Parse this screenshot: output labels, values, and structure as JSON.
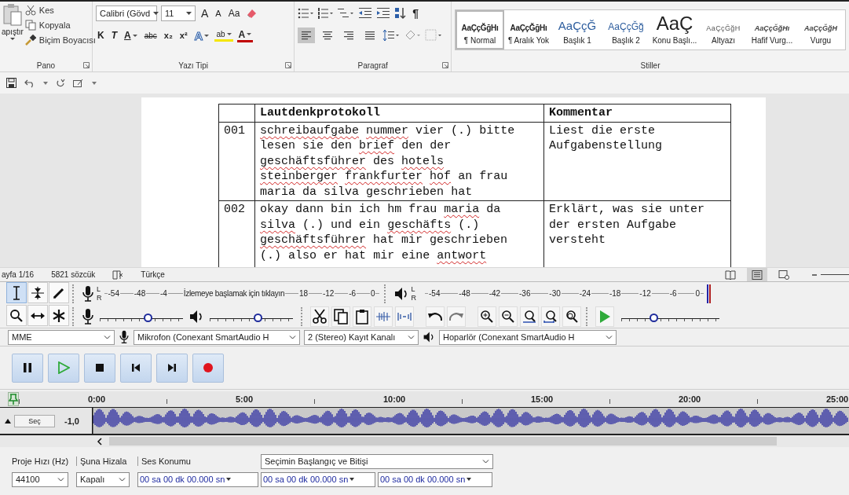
{
  "ribbon": {
    "groups": [
      {
        "kind": "clipboard",
        "label": "Pano",
        "paste": "apıştır",
        "items": [
          {
            "kind": "cut",
            "label": "Kes"
          },
          {
            "kind": "copy",
            "label": "Kopyala"
          },
          {
            "kind": "painter",
            "label": "Biçim Boyacısı"
          }
        ]
      },
      {
        "kind": "font",
        "label": "Yazı Tipi",
        "font_name": "Calibri (Gövd",
        "font_size": "11",
        "size_buttons": [
          {
            "kind": "grow",
            "label": "A"
          },
          {
            "kind": "shrink",
            "label": "A"
          }
        ],
        "case_button": "Aa",
        "format_buttons": [
          {
            "kind": "bold",
            "label": "K"
          },
          {
            "kind": "italic",
            "label": "T"
          },
          {
            "kind": "underline",
            "label": "A"
          },
          {
            "kind": "strike",
            "label": "abc"
          },
          {
            "kind": "sub",
            "label": "x₂"
          },
          {
            "kind": "sup",
            "label": "x²"
          },
          {
            "kind": "effects",
            "label": "A"
          },
          {
            "kind": "highlight",
            "label": "ab"
          },
          {
            "kind": "color",
            "label": "A"
          }
        ]
      },
      {
        "kind": "paragraph",
        "label": "Paragraf",
        "pilcrow": "¶",
        "align": [
          {
            "kind": "left",
            "selected": true
          },
          {
            "kind": "center",
            "selected": false
          },
          {
            "kind": "right",
            "selected": false
          },
          {
            "kind": "justify",
            "selected": false
          }
        ]
      },
      {
        "kind": "styles",
        "label": "Stiller",
        "styles": [
          {
            "preview": "AaÇçĞğHı",
            "name": "¶ Normal",
            "kind": "normal",
            "selected": true
          },
          {
            "preview": "AaÇçĞğHı",
            "name": "¶ Aralık Yok",
            "kind": "normal",
            "selected": false
          },
          {
            "preview": "AaÇçĞ",
            "name": "Başlık 1",
            "kind": "heading1",
            "selected": false
          },
          {
            "preview": "AaÇçĞğ",
            "name": "Başlık 2",
            "kind": "heading2",
            "selected": false
          },
          {
            "preview": "AaÇ",
            "name": "Konu Başlı...",
            "kind": "title",
            "selected": false
          },
          {
            "preview": "AaÇçĞğH",
            "name": "Altyazı",
            "kind": "subtitle",
            "selected": false
          },
          {
            "preview": "AaÇçĞğHı",
            "name": "Hafif Vurg...",
            "kind": "emphasis",
            "selected": false
          },
          {
            "preview": "AaÇçĞğH",
            "name": "Vurgu",
            "kind": "emphasis",
            "selected": false
          }
        ]
      }
    ]
  },
  "document": {
    "columns": [
      "Lautdenkprotokoll",
      "Kommentar"
    ],
    "rows": [
      {
        "number": "001",
        "comment": "Liest die erste Aufgabenstellung",
        "lines": [
          [
            {
              "text": "schreibaufgabe",
              "misspelled": true
            },
            {
              "text": "nummer",
              "misspelled": true
            },
            {
              "text": "vier",
              "misspelled": false
            },
            {
              "text": "(.)",
              "misspelled": false
            },
            {
              "text": "bitte",
              "misspelled": false
            }
          ],
          [
            {
              "text": "lesen",
              "misspelled": false
            },
            {
              "text": "sie",
              "misspelled": false
            },
            {
              "text": "den",
              "misspelled": false
            },
            {
              "text": "brief",
              "misspelled": true
            },
            {
              "text": "den",
              "misspelled": false
            },
            {
              "text": "der",
              "misspelled": false
            }
          ],
          [
            {
              "text": "geschäftsführer",
              "misspelled": true
            },
            {
              "text": "des",
              "misspelled": false
            },
            {
              "text": "hotels",
              "misspelled": true
            }
          ],
          [
            {
              "text": "steinberger",
              "misspelled": true
            },
            {
              "text": "frankfurter",
              "misspelled": true
            },
            {
              "text": "hof",
              "misspelled": true
            },
            {
              "text": "an",
              "misspelled": false
            },
            {
              "text": "frau",
              "misspelled": false
            }
          ],
          [
            {
              "text": "maria",
              "misspelled": false
            },
            {
              "text": "da",
              "misspelled": false
            },
            {
              "text": "silva",
              "misspelled": false
            },
            {
              "text": "geschrieben",
              "misspelled": false
            },
            {
              "text": "hat",
              "misspelled": false
            }
          ]
        ]
      },
      {
        "number": "002",
        "comment": "Erklärt, was sie unter der ersten Aufgabe versteht",
        "lines": [
          [
            {
              "text": "okay",
              "misspelled": false
            },
            {
              "text": "dann",
              "misspelled": false
            },
            {
              "text": "bin",
              "misspelled": false
            },
            {
              "text": "ich",
              "misspelled": false
            },
            {
              "text": "hm",
              "misspelled": false
            },
            {
              "text": "frau",
              "misspelled": false
            },
            {
              "text": "maria",
              "misspelled": true
            },
            {
              "text": "da",
              "misspelled": false
            }
          ],
          [
            {
              "text": "silva",
              "misspelled": true
            },
            {
              "text": "(.)",
              "misspelled": false
            },
            {
              "text": "und",
              "misspelled": false
            },
            {
              "text": "ein",
              "misspelled": false
            },
            {
              "text": "geschäfts",
              "misspelled": true
            },
            {
              "text": "(.)",
              "misspelled": false
            }
          ],
          [
            {
              "text": "geschäftsführer",
              "misspelled": true
            },
            {
              "text": "hat",
              "misspelled": false
            },
            {
              "text": "mir",
              "misspelled": false
            },
            {
              "text": "geschrieben",
              "misspelled": false
            }
          ],
          [
            {
              "text": "(.)",
              "misspelled": false
            },
            {
              "text": "also",
              "misspelled": false
            },
            {
              "text": "er",
              "misspelled": false
            },
            {
              "text": "hat",
              "misspelled": false
            },
            {
              "text": "mir",
              "misspelled": false
            },
            {
              "text": "eine",
              "misspelled": false
            },
            {
              "text": "antwort",
              "misspelled": true
            }
          ]
        ]
      }
    ]
  },
  "status_bar": {
    "page": "ayfa 1/16",
    "words": "5821 sözcük",
    "language": "Türkçe",
    "views": [
      {
        "kind": "read",
        "selected": false
      },
      {
        "kind": "print",
        "selected": true
      },
      {
        "kind": "web",
        "selected": false
      }
    ]
  },
  "audacity": {
    "tools": [
      {
        "kind": "select",
        "selected": true
      },
      {
        "kind": "envelope",
        "selected": false
      },
      {
        "kind": "draw",
        "selected": false
      },
      {
        "kind": "zoom",
        "selected": false
      },
      {
        "kind": "timeshift",
        "selected": false
      },
      {
        "kind": "multi",
        "selected": false
      }
    ],
    "record_meter": {
      "channels": [
        "L",
        "R"
      ],
      "ticks": [
        "-54",
        "-48",
        "-4"
      ],
      "message": "İzlemeye başlamak için tıklayın",
      "ticks_after": [
        "18",
        "-12",
        "-6",
        "0"
      ]
    },
    "play_meter": {
      "channels": [
        "L",
        "R"
      ],
      "ticks": [
        "-54",
        "-48",
        "-42",
        "-36",
        "-30",
        "-24",
        "-18",
        "-12",
        "-6",
        "0"
      ]
    },
    "record_volume": {
      "level": 0.58
    },
    "play_volume": {
      "level": 0.58
    },
    "play_speed": {
      "level": 0.33
    },
    "devices": {
      "host": "MME",
      "microphone": "Mikrofon (Conexant SmartAudio H",
      "channels": "2 (Stereo) Kayıt Kanalı",
      "speaker": "Hoparlör (Conexant SmartAudio H"
    },
    "transport": [
      {
        "kind": "pause"
      },
      {
        "kind": "play"
      },
      {
        "kind": "stop"
      },
      {
        "kind": "skip_start"
      },
      {
        "kind": "skip_end"
      },
      {
        "kind": "record"
      }
    ],
    "timeline": {
      "ticks": [
        "0:00",
        "5:00",
        "10:00",
        "15:00",
        "20:00",
        "25:00"
      ]
    },
    "track": {
      "select_button": "Seç",
      "scale_label": "-1,0"
    },
    "selection_bar": {
      "rate_label": "Proje Hızı (Hz)",
      "snap_label": "Şuna Hizala",
      "position_label": "Ses Konumu",
      "mode": "Seçimin Başlangıç ve Bitişi",
      "rate": "44100",
      "snap": "Kapalı",
      "position": "00 sa 00 dk 00.000 sn",
      "selection_start": "00 sa 00 dk 00.000 sn",
      "selection_end": "00 sa 00 dk 00.000 sn"
    }
  }
}
